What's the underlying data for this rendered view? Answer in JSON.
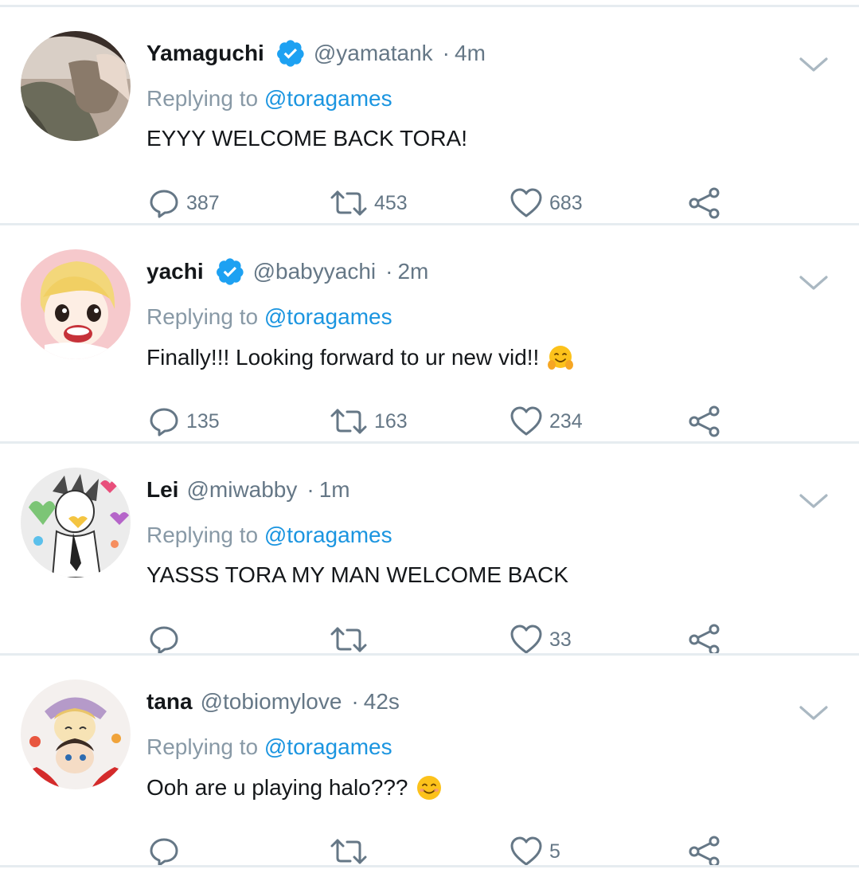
{
  "tweets": [
    {
      "name": "Yamaguchi",
      "verified": true,
      "handle": "@yamatank",
      "separator": "·",
      "time": "4m",
      "replying_prefix": "Replying to",
      "replying_to": "@toragames",
      "text": "EYYY WELCOME BACK TORA!",
      "emoji": null,
      "replies": "387",
      "retweets": "453",
      "likes": "683"
    },
    {
      "name": "yachi",
      "verified": true,
      "handle": "@babyyachi",
      "separator": "·",
      "time": "2m",
      "replying_prefix": "Replying to",
      "replying_to": "@toragames",
      "text": "Finally!!! Looking forward to ur new vid!!",
      "emoji": "hugging-face-emoji",
      "replies": "135",
      "retweets": "163",
      "likes": "234"
    },
    {
      "name": "Lei",
      "verified": false,
      "handle": "@miwabby",
      "separator": "·",
      "time": "1m",
      "replying_prefix": "Replying to",
      "replying_to": "@toragames",
      "text": "YASSS TORA MY MAN WELCOME BACK",
      "emoji": null,
      "replies": "",
      "retweets": "",
      "likes": "33"
    },
    {
      "name": "tana",
      "verified": false,
      "handle": "@tobiomylove",
      "separator": "·",
      "time": "42s",
      "replying_prefix": "Replying to",
      "replying_to": "@toragames",
      "text": "Ooh are u playing halo???",
      "emoji": "smiling-face-emoji",
      "replies": "",
      "retweets": "",
      "likes": "5"
    }
  ],
  "colors": {
    "name": "#14171a",
    "secondary": "#657786",
    "replying": "#8899a6",
    "mention": "#1b95e0",
    "verified": "#1da1f2",
    "divider": "#e6ecf0"
  },
  "icons": {
    "verified": "verified-badge-icon",
    "caret": "chevron-down-icon",
    "reply": "reply-bubble-icon",
    "retweet": "retweet-icon",
    "like": "heart-icon",
    "share": "share-icon"
  }
}
